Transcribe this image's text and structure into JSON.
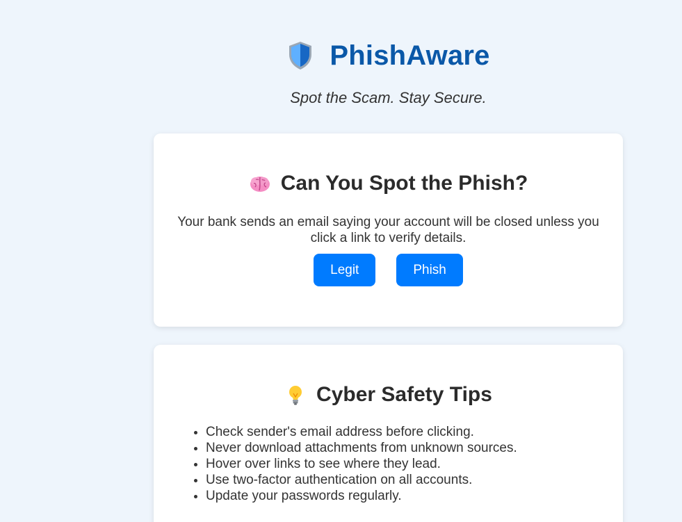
{
  "header": {
    "app_title": "PhishAware",
    "tagline": "Spot the Scam. Stay Secure."
  },
  "quiz": {
    "heading": "Can You Spot the Phish?",
    "question": "Your bank sends an email saying your account will be closed unless you click a link to verify details.",
    "buttons": {
      "legit_label": "Legit",
      "phish_label": "Phish"
    }
  },
  "tips": {
    "heading": "Cyber Safety Tips",
    "items": [
      "Check sender's email address before clicking.",
      "Never download attachments from unknown sources.",
      "Hover over links to see where they lead.",
      "Use two-factor authentication on all accounts.",
      "Update your passwords regularly."
    ]
  },
  "icons": {
    "logo": "shield-icon",
    "quiz": "brain-icon",
    "tips": "lightbulb-icon"
  },
  "colors": {
    "page_background": "#eef5fc",
    "brand_title": "#0a58a8",
    "button_primary": "#007bff",
    "card_background": "#ffffff"
  }
}
